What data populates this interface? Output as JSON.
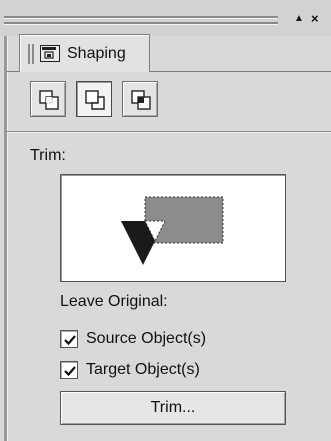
{
  "docker": {
    "tab_label": "Shaping",
    "tab_icon": "shaping-docker-icon",
    "title_buttons": {
      "pin": "▲",
      "close": "×"
    }
  },
  "modes": [
    {
      "icon": "weld-icon",
      "selected": false
    },
    {
      "icon": "trim-icon",
      "selected": true
    },
    {
      "icon": "intersect-icon",
      "selected": false
    }
  ],
  "section": {
    "title": "Trim:",
    "preview_icon": "trim-preview-icon"
  },
  "options": {
    "leave_original_label": "Leave Original:",
    "source_label": "Source Object(s)",
    "source_checked": true,
    "target_label": "Target Object(s)",
    "target_checked": true
  },
  "action": {
    "button_label": "Trim..."
  },
  "colors": {
    "panel_bg": "#d9d9d9",
    "preview_shape": "#8c8c8c",
    "arrow": "#1a1a1a"
  }
}
